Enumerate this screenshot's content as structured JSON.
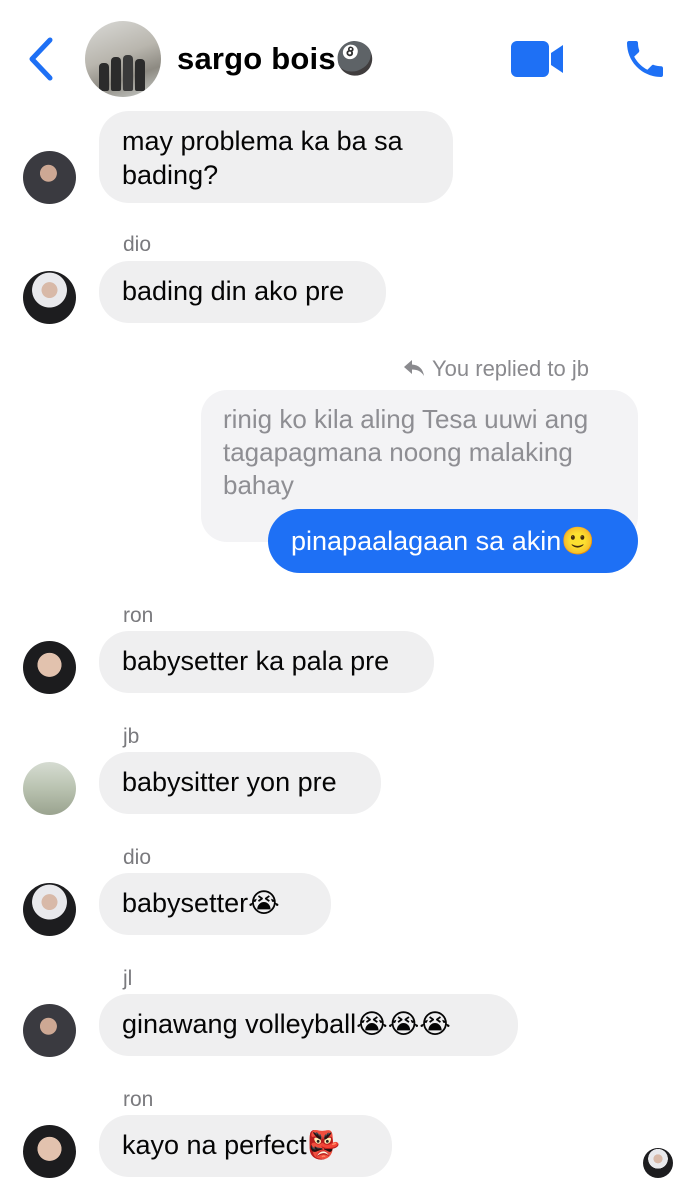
{
  "header": {
    "title": "sargo bois🎱"
  },
  "messages": [
    {
      "text": "may problema ka ba sa bading?"
    },
    {
      "sender": "dio",
      "text": "bading din ako pre"
    },
    {
      "reply_note": "You replied to jb",
      "quoted": "rinig ko kila aling Tesa uuwi ang tagapagmana noong malaking bahay",
      "text": "pinapaalagaan sa akin🙂"
    },
    {
      "sender": "ron",
      "text": "babysetter ka pala pre"
    },
    {
      "sender": "jb",
      "text": "babysitter yon pre"
    },
    {
      "sender": "dio",
      "text": "babysetter😭"
    },
    {
      "sender": "jl",
      "text": "ginawang volleyball😭😭😭"
    },
    {
      "sender": "ron",
      "text": "kayo na perfect👺"
    }
  ],
  "colors": {
    "accent": "#1e70f5",
    "incoming_bubble": "#efeff0",
    "quoted_bubble": "#f3f3f5"
  },
  "icons": [
    "back-chevron-icon",
    "video-camera-icon",
    "phone-icon",
    "reply-arrow-icon"
  ]
}
